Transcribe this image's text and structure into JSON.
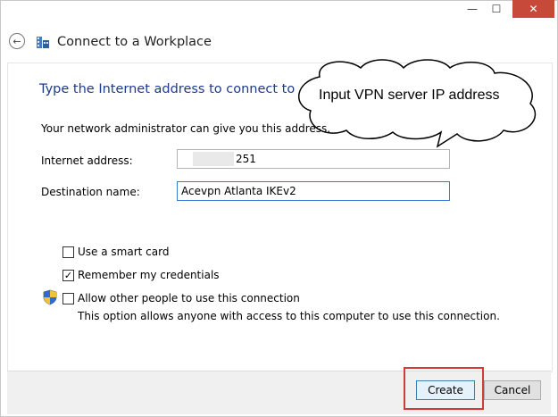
{
  "window": {
    "minimize_glyph": "—",
    "maximize_glyph": "☐",
    "close_glyph": "✕"
  },
  "header": {
    "back_icon": "back-arrow-icon",
    "app_icon": "workplace-icon",
    "title": "Connect to a Workplace"
  },
  "main": {
    "heading": "Type the Internet address to connect to",
    "description": "Your network administrator can give you this address.",
    "callout": "Input VPN server IP address",
    "fields": {
      "address_label": "Internet address:",
      "address_value_visible": "251",
      "destination_label": "Destination name:",
      "destination_value": "Acevpn Atlanta IKEv2"
    },
    "options": {
      "smart_card": {
        "label": "Use a smart card",
        "checked": false
      },
      "remember": {
        "label": "Remember my credentials",
        "checked": true
      },
      "allow_others": {
        "label": "Allow other people to use this connection",
        "description": "This option allows anyone with access to this computer to use this connection.",
        "checked": false,
        "icon": "uac-shield-icon"
      }
    }
  },
  "footer": {
    "create_label": "Create",
    "cancel_label": "Cancel"
  },
  "colors": {
    "heading": "#1e3a8a",
    "close_button": "#c7493a",
    "highlight": "#d43a34"
  }
}
